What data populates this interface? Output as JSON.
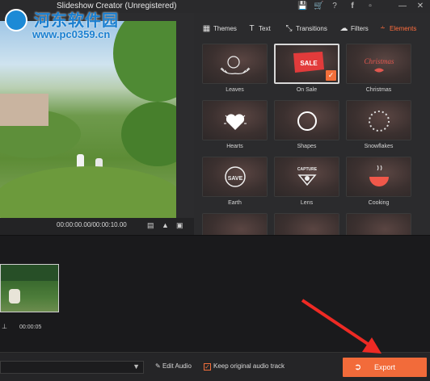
{
  "window": {
    "title": "Slideshow Creator (Unregistered)",
    "title_icons": [
      "save-icon",
      "cart-icon",
      "help-icon",
      "facebook-icon",
      "feedback-icon",
      "minimize-icon",
      "close-icon"
    ]
  },
  "watermark": {
    "title": "河东软件园",
    "url": "www.pc0359.cn"
  },
  "preview": {
    "timecode": "00:00:00.00/00:00:10.00"
  },
  "tabs": [
    {
      "label": "Themes",
      "icon": "themes-icon"
    },
    {
      "label": "Text",
      "icon": "text-icon"
    },
    {
      "label": "Transitions",
      "icon": "transitions-icon"
    },
    {
      "label": "Filters",
      "icon": "filters-icon"
    },
    {
      "label": "Elements",
      "icon": "elements-icon",
      "active": true
    }
  ],
  "elements": [
    {
      "label": "Leaves"
    },
    {
      "label": "On Sale",
      "selected": true,
      "art": "SALE"
    },
    {
      "label": "Christmas",
      "art": "Christmas"
    },
    {
      "label": "Hearts"
    },
    {
      "label": "Shapes"
    },
    {
      "label": "Snowflakes"
    },
    {
      "label": "Earth",
      "art": "SAVE"
    },
    {
      "label": "Lens",
      "art": "CAPTURE"
    },
    {
      "label": "Cooking"
    },
    {
      "label": ""
    },
    {
      "label": ""
    },
    {
      "label": ""
    }
  ],
  "timeline": {
    "clip_duration": "00:00:05"
  },
  "bottom": {
    "edit_audio": "Edit Audio",
    "keep_audio": "Keep original audio track",
    "keep_audio_checked": true,
    "export": "Export"
  },
  "colors": {
    "accent": "#f26b3a",
    "background": "#1e1e20",
    "panel": "#2b2b2d"
  }
}
